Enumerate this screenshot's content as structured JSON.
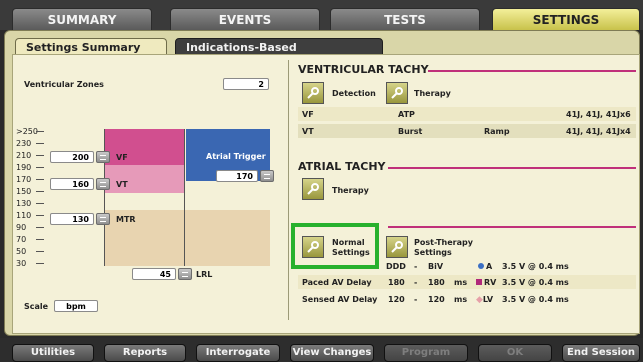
{
  "top_tabs": [
    "SUMMARY",
    "EVENTS",
    "TESTS",
    "SETTINGS"
  ],
  "subtabs": {
    "active": "Settings Summary",
    "inactive": "Indications-Based Programming"
  },
  "left_panel": {
    "ventricular_zones_label": "Ventricular Zones",
    "ventricular_zones_value": "2",
    "y_ticks": [
      ">250",
      "230",
      "210",
      "190",
      "170",
      "150",
      "130",
      "110",
      "90",
      "70",
      "50",
      "30"
    ],
    "vf": {
      "value": "200",
      "label": "VF"
    },
    "vt": {
      "value": "160",
      "label": "VT"
    },
    "mtr": {
      "value": "130",
      "label": "MTR"
    },
    "lrl": {
      "value": "45",
      "label": "LRL"
    },
    "atrial_trigger": {
      "label": "Atrial Trigger",
      "value": "170"
    },
    "scale_label": "Scale",
    "scale_value": "bpm",
    "colors": {
      "vf": "#d14f8f",
      "vt": "#e69ab9",
      "mtr": "#e8d4b0",
      "atrial": "#3a67b2"
    }
  },
  "vent_tachy": {
    "title": "VENTRICULAR TACHY",
    "detection_label": "Detection",
    "therapy_label": "Therapy",
    "rows": [
      [
        "VF",
        "ATP",
        "",
        "41J, 41J, 41Jx6"
      ],
      [
        "VT",
        "Burst",
        "Ramp",
        "41J, 41J, 41Jx4"
      ]
    ]
  },
  "atrial_tachy": {
    "title": "ATRIAL TACHY",
    "therapy_label": "Therapy"
  },
  "brady": {
    "normal_label_1": "Normal",
    "normal_label_2": "Settings",
    "post_label_1": "Post-Therapy",
    "post_label_2": "Settings",
    "mode": "DDD",
    "mode_dash": "-",
    "mode_val": "BiV",
    "paced_label": "Paced AV Delay",
    "paced_from": "180",
    "paced_dash": "-",
    "paced_to": "180",
    "paced_unit": "ms",
    "sensed_label": "Sensed AV Delay",
    "sensed_from": "120",
    "sensed_dash": "-",
    "sensed_to": "120",
    "sensed_unit": "ms",
    "leads": [
      {
        "name": "A",
        "value": "3.5 V @ 0.4 ms",
        "color": "#3b6fc4"
      },
      {
        "name": "RV",
        "value": "3.5 V @ 0.4 ms",
        "color": "#b0287a"
      },
      {
        "name": "LV",
        "value": "3.5 V @ 0.4 ms",
        "color": "#e6a0a8"
      }
    ]
  },
  "bottom_buttons": [
    {
      "label": "Utilities",
      "enabled": true
    },
    {
      "label": "Reports",
      "enabled": true
    },
    {
      "label": "Interrogate",
      "enabled": true
    },
    {
      "label": "View Changes",
      "enabled": true
    },
    {
      "label": "Program",
      "enabled": false
    },
    {
      "label": "OK",
      "enabled": false
    },
    {
      "label": "End Session",
      "enabled": true
    }
  ]
}
